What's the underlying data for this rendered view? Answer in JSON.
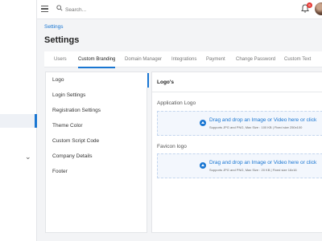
{
  "topbar": {
    "search_placeholder": "Search...",
    "notification_count": "6"
  },
  "breadcrumb": "Settings",
  "page_title": "Settings",
  "tabs": [
    {
      "label": "Users"
    },
    {
      "label": "Custom Branding"
    },
    {
      "label": "Domain Manager"
    },
    {
      "label": "Integrations"
    },
    {
      "label": "Payment"
    },
    {
      "label": "Change Password"
    },
    {
      "label": "Custom Text"
    }
  ],
  "menu": [
    {
      "label": "Logo"
    },
    {
      "label": "Login Settings"
    },
    {
      "label": "Registration Settings"
    },
    {
      "label": "Theme Color"
    },
    {
      "label": "Custom Script Code"
    },
    {
      "label": "Company Details"
    },
    {
      "label": "Footer"
    }
  ],
  "panel": {
    "title": "Logo's",
    "application_logo": {
      "label": "Application Logo",
      "drop_text": "Drag and drop an Image or Video here or click",
      "hint": "Supports JPG and PNG, Max Size : 100 KB | Fixed size 250x100"
    },
    "favicon_logo": {
      "label": "Favicon logo",
      "drop_text": "Drag and drop an Image or Video here or click",
      "hint": "Supports JPG and PNG, Max Size : 20 KB | Fixed size 16x16"
    }
  },
  "colors": {
    "accent": "#1976d2",
    "badge": "#e53935"
  }
}
